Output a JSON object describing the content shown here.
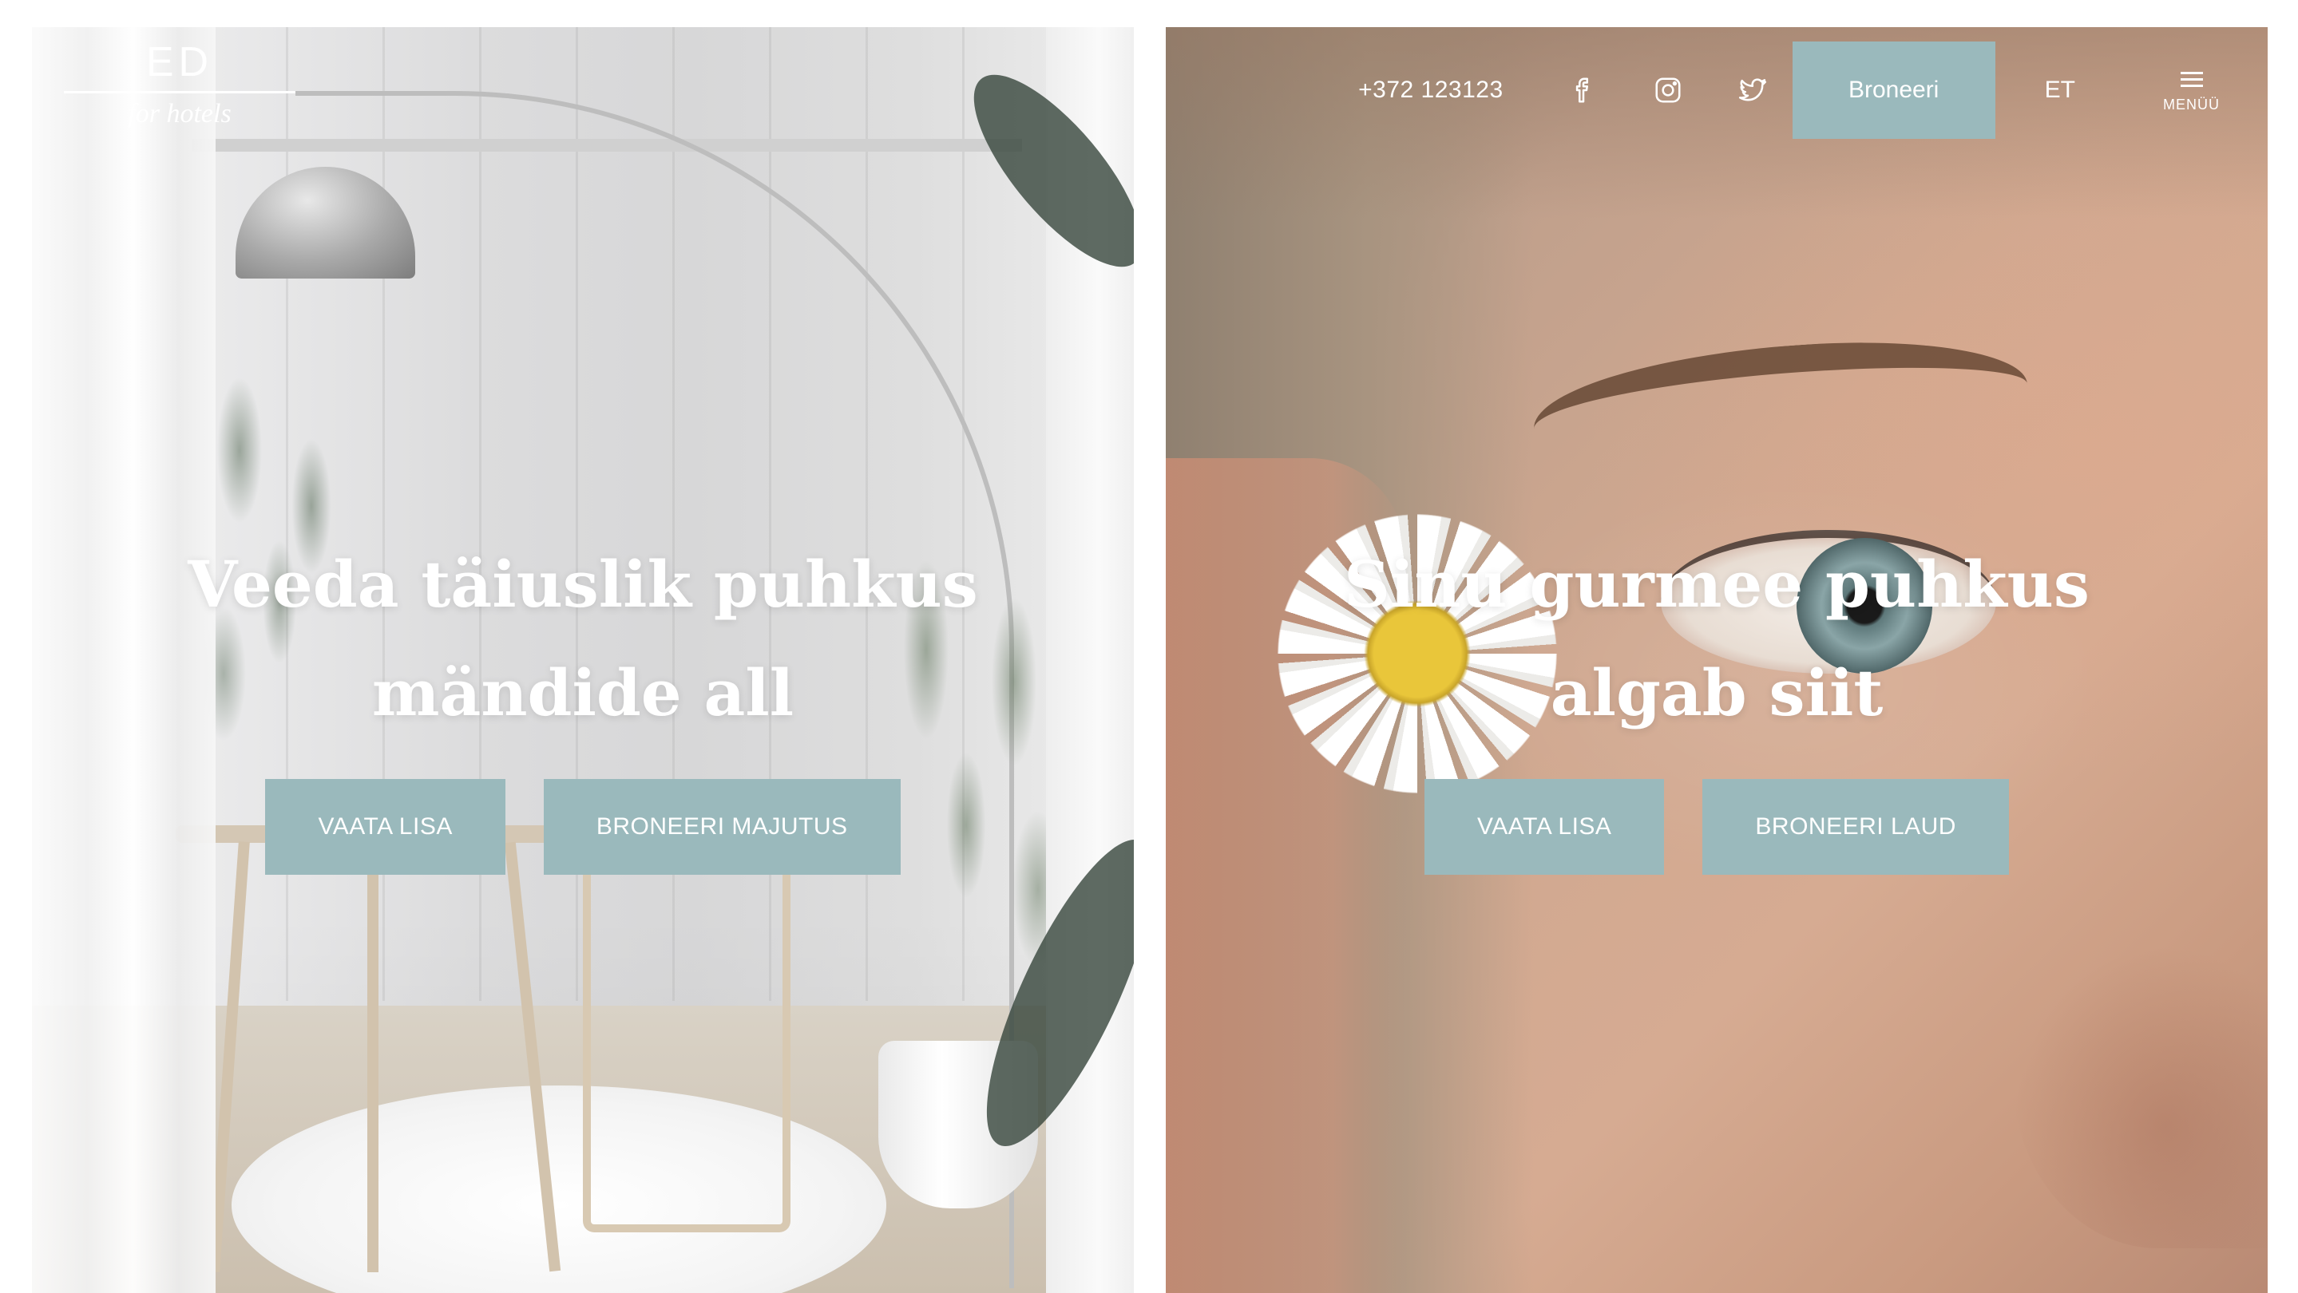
{
  "logo": {
    "main": "ED",
    "sub": "for hotels"
  },
  "nav": {
    "phone": "+372 123123",
    "social_icons": [
      "facebook-icon",
      "instagram-icon",
      "twitter-icon"
    ],
    "book_label": "Broneeri",
    "language": "ET",
    "menu_label": "MENÜÜ"
  },
  "panels": [
    {
      "title_line1": "Veeda täiuslik puhkus",
      "title_line2": "mändide all",
      "button_primary": "VAATA LISA",
      "button_secondary": "BRONEERI MAJUTUS"
    },
    {
      "title_line1": "Sinu gurmee puhkus",
      "title_line2": "algab siit",
      "button_primary": "VAATA LISA",
      "button_secondary": "BRONEERI LAUD"
    }
  ],
  "colors": {
    "accent": "#9ab9bc",
    "text_on_image": "#ffffff",
    "page_background": "#ffffff"
  }
}
